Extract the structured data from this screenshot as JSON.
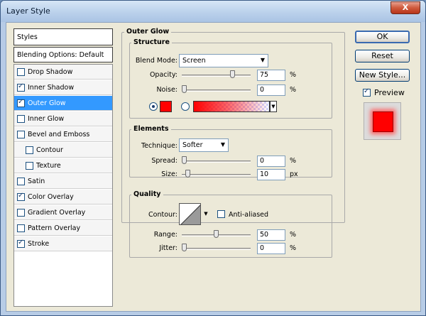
{
  "window": {
    "title": "Layer Style",
    "close": "X"
  },
  "styles_panel": {
    "header": "Styles",
    "blending_options": "Blending Options: Default",
    "items": [
      {
        "label": "Drop Shadow",
        "checked": false,
        "indent": false,
        "selected": false
      },
      {
        "label": "Inner Shadow",
        "checked": true,
        "indent": false,
        "selected": false
      },
      {
        "label": "Outer Glow",
        "checked": true,
        "indent": false,
        "selected": true
      },
      {
        "label": "Inner Glow",
        "checked": false,
        "indent": false,
        "selected": false
      },
      {
        "label": "Bevel and Emboss",
        "checked": false,
        "indent": false,
        "selected": false
      },
      {
        "label": "Contour",
        "checked": false,
        "indent": true,
        "selected": false
      },
      {
        "label": "Texture",
        "checked": false,
        "indent": true,
        "selected": false
      },
      {
        "label": "Satin",
        "checked": false,
        "indent": false,
        "selected": false
      },
      {
        "label": "Color Overlay",
        "checked": true,
        "indent": false,
        "selected": false
      },
      {
        "label": "Gradient Overlay",
        "checked": false,
        "indent": false,
        "selected": false
      },
      {
        "label": "Pattern Overlay",
        "checked": false,
        "indent": false,
        "selected": false
      },
      {
        "label": "Stroke",
        "checked": true,
        "indent": false,
        "selected": false
      }
    ]
  },
  "outer_glow": {
    "title": "Outer Glow",
    "structure": {
      "title": "Structure",
      "blend_mode_label": "Blend Mode:",
      "blend_mode_value": "Screen",
      "opacity_label": "Opacity:",
      "opacity_value": "75",
      "opacity_level": 75,
      "opacity_unit": "%",
      "noise_label": "Noise:",
      "noise_value": "0",
      "noise_level": 0,
      "noise_unit": "%",
      "glow_color": "#ff0000"
    },
    "elements": {
      "title": "Elements",
      "technique_label": "Technique:",
      "technique_value": "Softer",
      "spread_label": "Spread:",
      "spread_value": "0",
      "spread_unit": "%",
      "size_label": "Size:",
      "size_value": "10",
      "size_unit": "px"
    },
    "quality": {
      "title": "Quality",
      "contour_label": "Contour:",
      "anti_aliased_label": "Anti-aliased",
      "anti_aliased_checked": false,
      "range_label": "Range:",
      "range_value": "50",
      "range_level": 50,
      "range_unit": "%",
      "jitter_label": "Jitter:",
      "jitter_value": "0",
      "jitter_unit": "%"
    }
  },
  "buttons": {
    "ok": "OK",
    "reset": "Reset",
    "new_style": "New Style...",
    "preview_label": "Preview",
    "preview_checked": true
  },
  "colors": {
    "selection": "#3399ff",
    "glow": "#ff0000"
  }
}
